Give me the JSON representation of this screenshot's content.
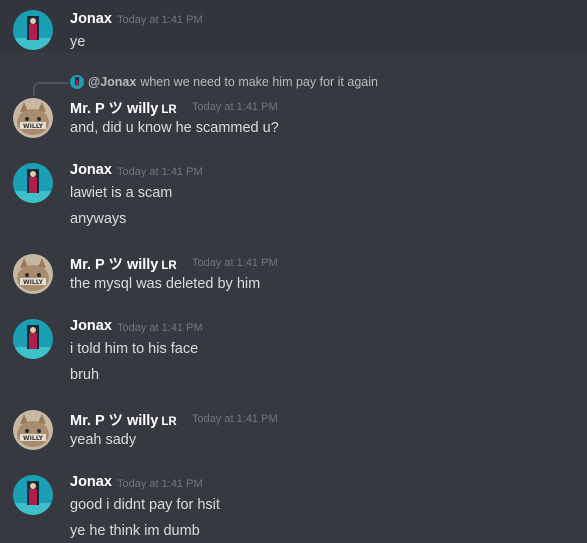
{
  "colors": {
    "background": "#36393f",
    "username": "#ffffff",
    "message_text": "#dcddde",
    "timestamp": "#72767d",
    "reply_text": "#b9bbbe"
  },
  "users": {
    "jonax": {
      "name": "Jonax",
      "avatar_icon": "jonax-avatar-icon"
    },
    "willy": {
      "name": "Mr. P ツ willy",
      "tag": "LR",
      "avatar_icon": "willy-avatar-icon"
    }
  },
  "reply": {
    "mention": "@Jonax",
    "text": "when we need to make him pay for it again"
  },
  "messages": [
    {
      "author": "Jonax",
      "timestamp": "Today at 1:41 PM",
      "lines": [
        "ye"
      ]
    },
    {
      "author": "Mr. P ツ willy",
      "tag": "LR",
      "timestamp": "Today at 1:41 PM",
      "lines": [
        "and, did u know he scammed u?"
      ]
    },
    {
      "author": "Jonax",
      "timestamp": "Today at 1:41 PM",
      "lines": [
        "lawiet is a scam",
        "anyways"
      ]
    },
    {
      "author": "Mr. P ツ willy",
      "tag": "LR",
      "timestamp": "Today at 1:41 PM",
      "lines": [
        "the mysql was deleted by him"
      ]
    },
    {
      "author": "Jonax",
      "timestamp": "Today at 1:41 PM",
      "lines": [
        "i told him to his face",
        "bruh"
      ]
    },
    {
      "author": "Mr. P ツ willy",
      "tag": "LR",
      "timestamp": "Today at 1:41 PM",
      "lines": [
        "yeah sady"
      ]
    },
    {
      "author": "Jonax",
      "timestamp": "Today at 1:41 PM",
      "lines": [
        "good i didnt pay for hsit",
        "ye he think im dumb"
      ]
    }
  ]
}
